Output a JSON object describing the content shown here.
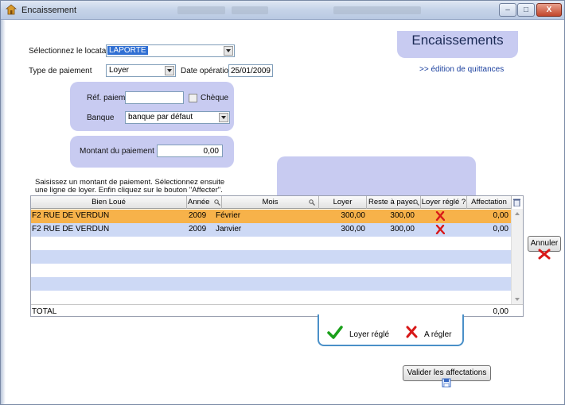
{
  "window": {
    "title": "Encaissement",
    "buttons": {
      "minimize": "–",
      "maximize": "□",
      "close": "X"
    }
  },
  "header": {
    "heading": "Encaissements",
    "quittances_link": ">> édition de quittances"
  },
  "form": {
    "locataire_label": "Sélectionnez le locataire",
    "locataire_value": "LAPORTE",
    "type_label": "Type de paiement",
    "type_value": "Loyer",
    "date_label": "Date opération",
    "date_value": "25/01/2009",
    "ref_label": "Réf. paiement",
    "ref_value": "",
    "cheque_label": "Chèque",
    "banque_label": "Banque",
    "banque_value": "banque par défaut",
    "montant_label": "Montant du paiement",
    "montant_value": "0,00"
  },
  "instructions": "Saisissez un montant de paiement. Sélectionnez ensuite une ligne de loyer. Enfin cliquez sur le bouton \"Affecter\".",
  "table": {
    "columns": [
      "Bien Loué",
      "Année",
      "Mois",
      "Loyer",
      "Reste à payer",
      "Loyer réglé ?",
      "Affectation"
    ],
    "rows": [
      {
        "bien": "F2 RUE DE VERDUN",
        "annee": "2009",
        "mois": "Février",
        "loyer": "300,00",
        "reste": "300,00",
        "affectation": "0,00"
      },
      {
        "bien": "F2 RUE DE VERDUN",
        "annee": "2009",
        "mois": "Janvier",
        "loyer": "300,00",
        "reste": "300,00",
        "affectation": "0,00"
      }
    ],
    "total_label": "TOTAL",
    "total_value": "0,00"
  },
  "actions": {
    "annuler": "Annuler",
    "valider": "Valider les affectations"
  },
  "legend": {
    "regle": "Loyer réglé",
    "a_regler": "A régler"
  },
  "colors": {
    "panel": "#c8cbf1",
    "selected_row": "#f7b24a",
    "alt_row": "#cdd9f5",
    "check_green": "#1aa01a",
    "cross_red": "#d81818"
  },
  "icons": [
    "app-icon",
    "search-icon",
    "trash-icon",
    "check-icon",
    "cross-icon",
    "save-icon"
  ]
}
